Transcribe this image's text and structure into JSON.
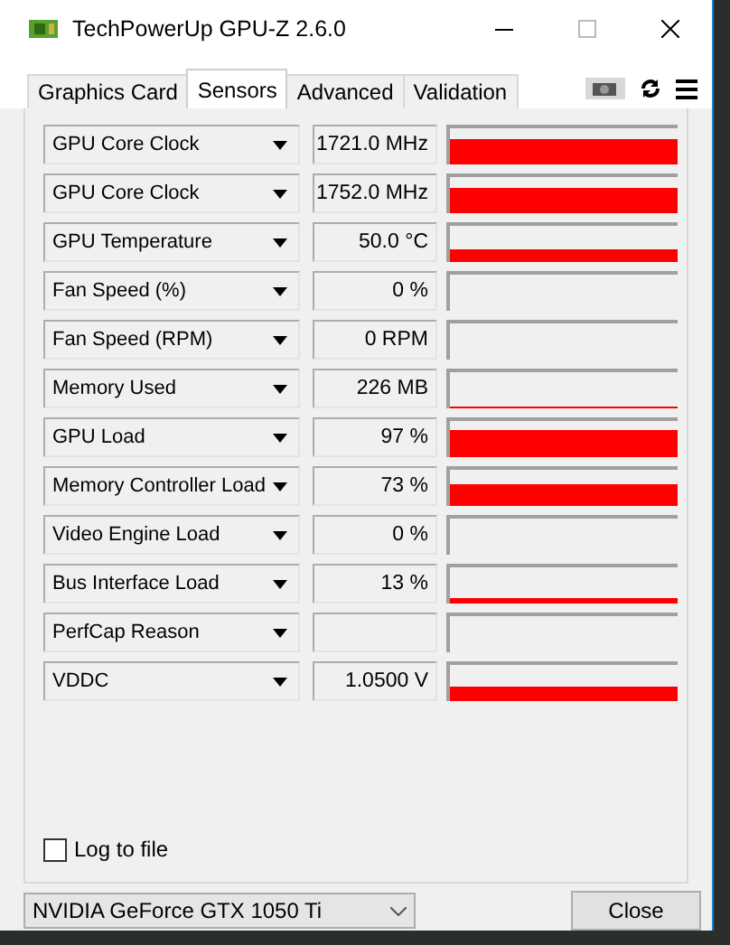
{
  "window": {
    "title": "TechPowerUp GPU-Z 2.6.0"
  },
  "tabs": [
    {
      "label": "Graphics Card",
      "selected": false
    },
    {
      "label": "Sensors",
      "selected": true
    },
    {
      "label": "Advanced",
      "selected": false
    },
    {
      "label": "Validation",
      "selected": false
    }
  ],
  "sensors": [
    {
      "name": "GPU Core Clock",
      "value": "1721.0 MHz"
    },
    {
      "name": "GPU Core Clock",
      "value": "1752.0 MHz"
    },
    {
      "name": "GPU Temperature",
      "value": "50.0 °C"
    },
    {
      "name": "Fan Speed (%)",
      "value": "0 %"
    },
    {
      "name": "Fan Speed (RPM)",
      "value": "0 RPM"
    },
    {
      "name": "Memory Used",
      "value": "226 MB"
    },
    {
      "name": "GPU Load",
      "value": "97 %"
    },
    {
      "name": "Memory Controller Load",
      "value": "73 %"
    },
    {
      "name": "Video Engine Load",
      "value": "0 %"
    },
    {
      "name": "Bus Interface Load",
      "value": "13 %"
    },
    {
      "name": "PerfCap Reason"
    },
    {
      "name": "VDDC",
      "value": "1.0500 V"
    }
  ],
  "log_to_file": {
    "label": "Log to file",
    "checked": false
  },
  "gpu_select": {
    "value": "NVIDIA GeForce GTX 1050 Ti"
  },
  "close_button": "Close"
}
